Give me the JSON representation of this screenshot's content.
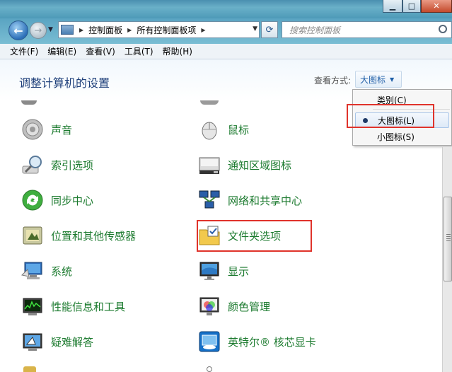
{
  "address": {
    "crumbs": [
      "控制面板",
      "所有控制面板项"
    ]
  },
  "search": {
    "placeholder": "搜索控制面板"
  },
  "menu": [
    "文件(F)",
    "编辑(E)",
    "查看(V)",
    "工具(T)",
    "帮助(H)"
  ],
  "page": {
    "title": "调整计算机的设置",
    "view_label": "查看方式:",
    "view_value": "大图标"
  },
  "dropdown": {
    "items": [
      "类别(C)",
      "大图标(L)",
      "小图标(S)"
    ],
    "selected": "大图标(L)"
  },
  "items": {
    "left": [
      "声音",
      "索引选项",
      "同步中心",
      "位置和其他传感器",
      "系统",
      "性能信息和工具",
      "疑难解答"
    ],
    "right": [
      "鼠标",
      "通知区域图标",
      "网络和共享中心",
      "文件夹选项",
      "显示",
      "颜色管理",
      "英特尔® 核芯显卡"
    ]
  },
  "colors": {
    "item_text": "#1b7a2e",
    "title": "#1e3f7a",
    "highlight": "#e0332b",
    "link": "#1f5fa8"
  }
}
